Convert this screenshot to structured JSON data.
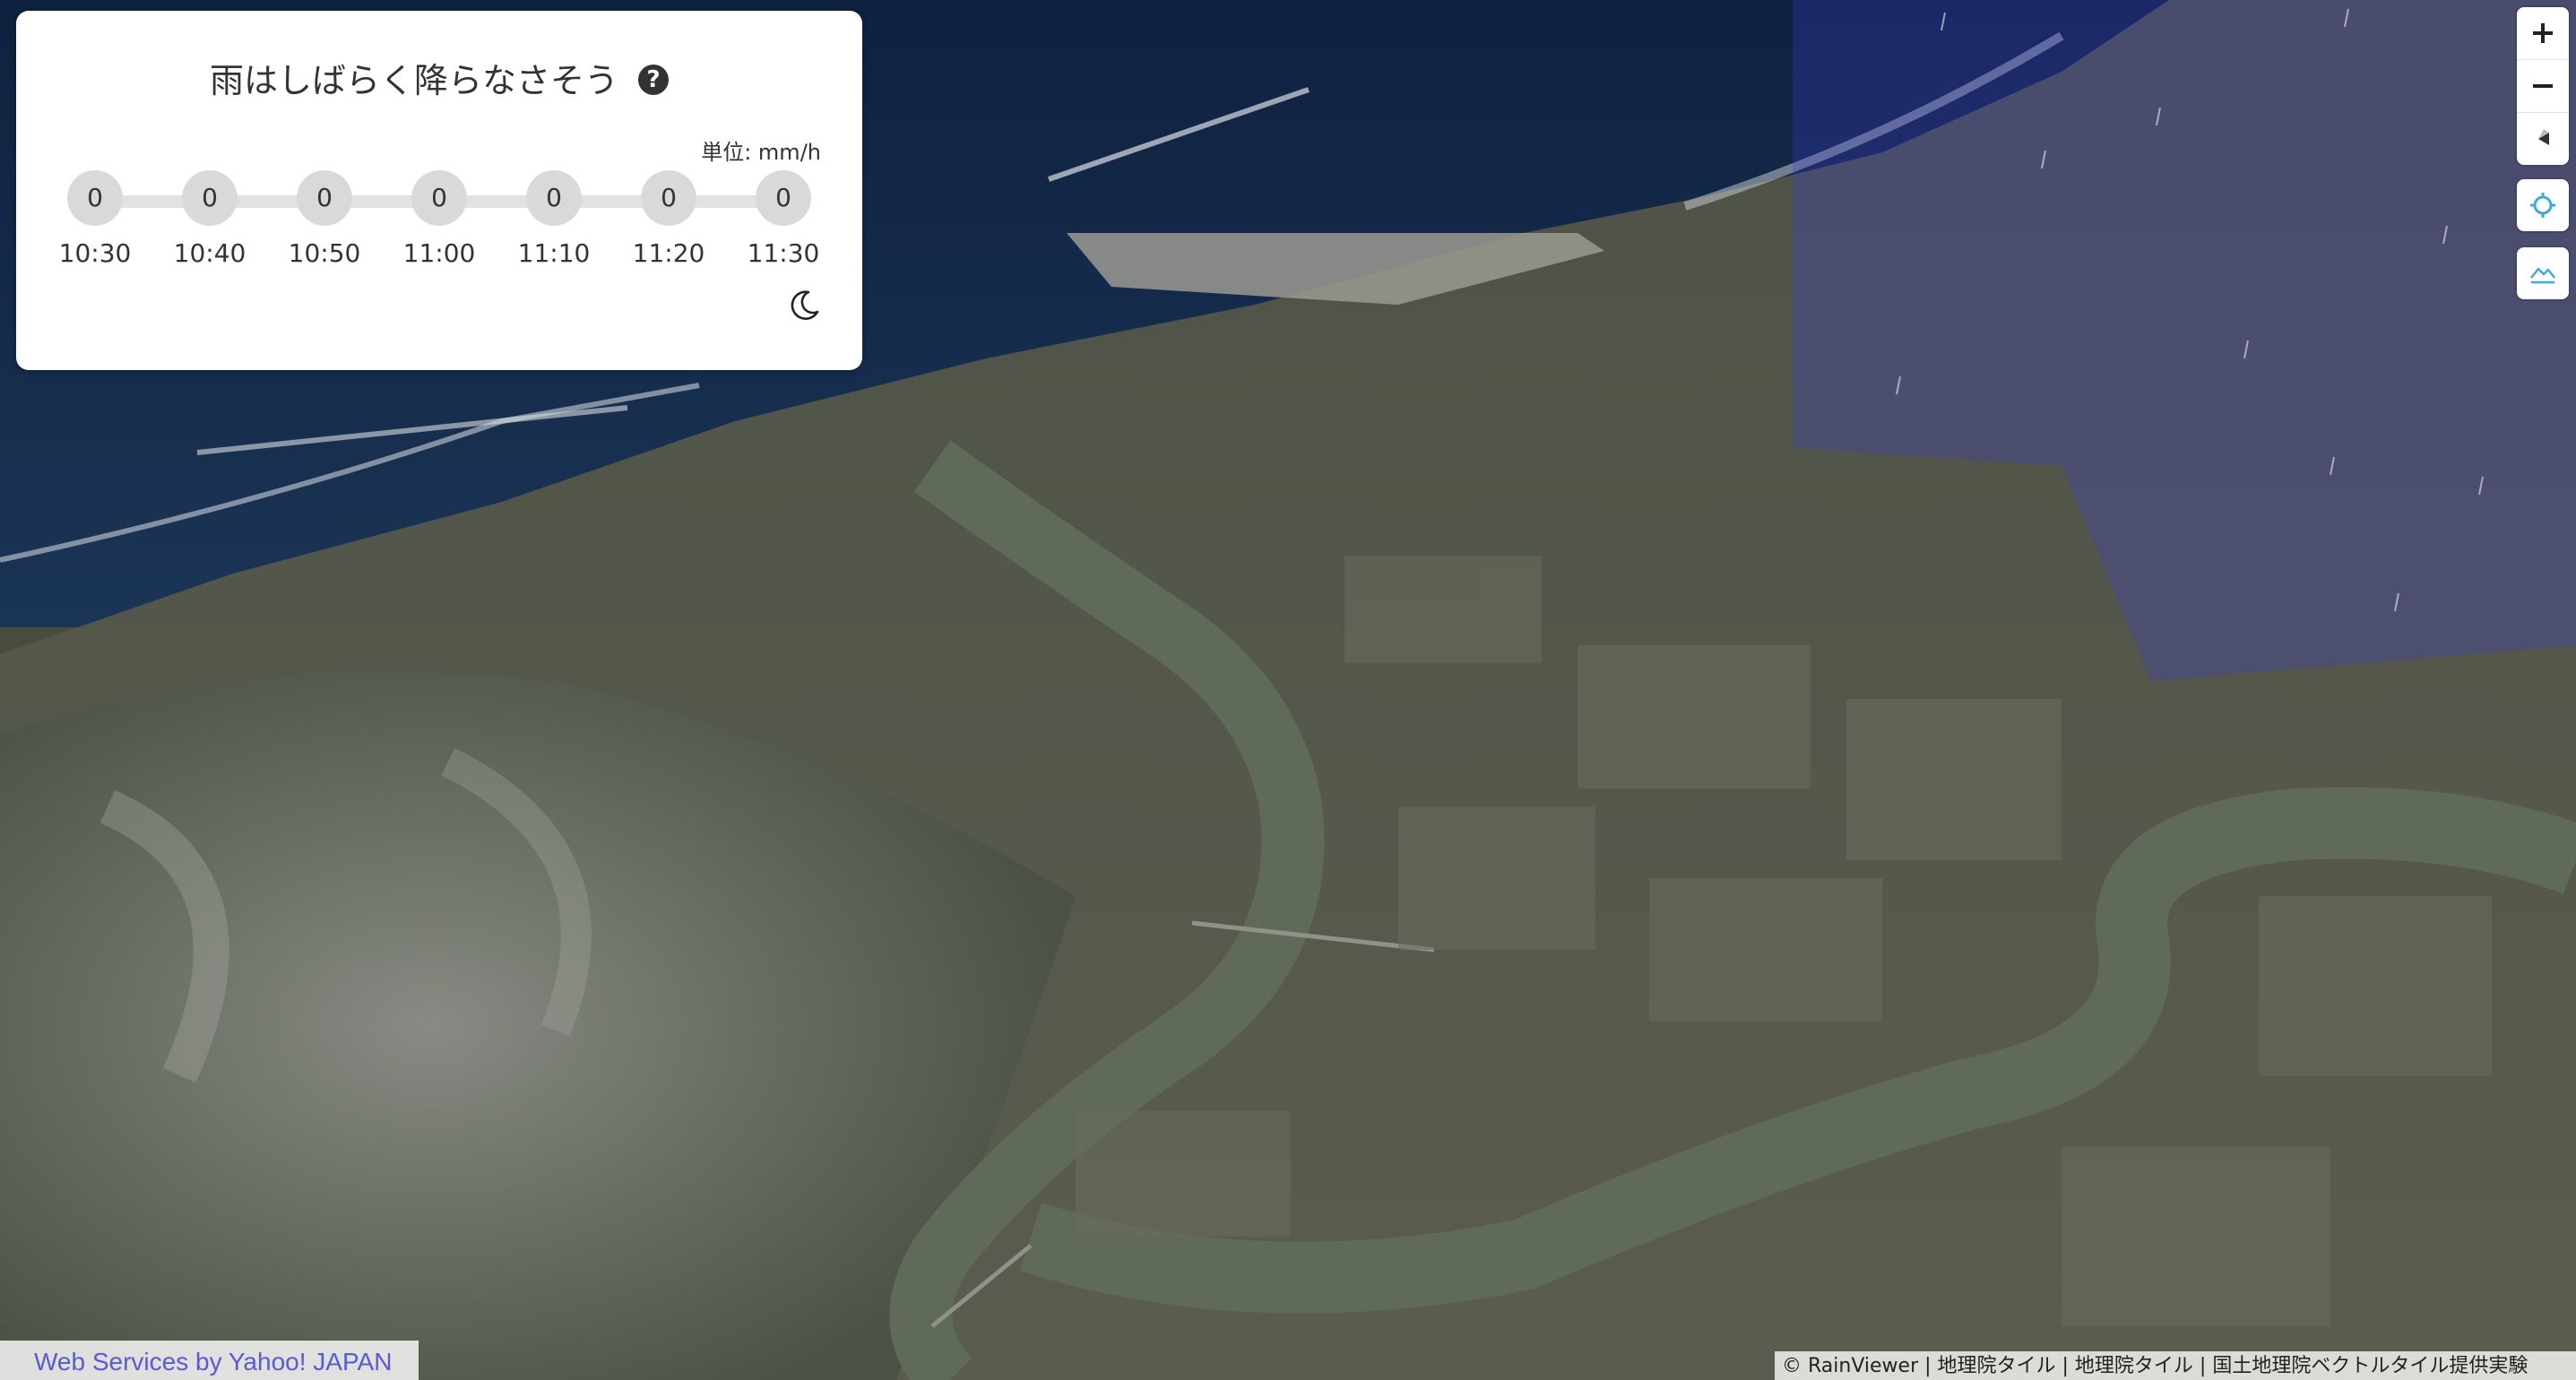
{
  "panel": {
    "title": "雨はしばらく降らなさそう",
    "help_icon": "?",
    "unit": "単位: mm/h",
    "forecast": [
      {
        "time": "10:30",
        "value": "0"
      },
      {
        "time": "10:40",
        "value": "0"
      },
      {
        "time": "10:50",
        "value": "0"
      },
      {
        "time": "11:00",
        "value": "0"
      },
      {
        "time": "11:10",
        "value": "0"
      },
      {
        "time": "11:20",
        "value": "0"
      },
      {
        "time": "11:30",
        "value": "0"
      }
    ],
    "theme_icon": "moon-icon"
  },
  "controls": {
    "zoom_in": "zoom-in-icon",
    "zoom_out": "zoom-out-icon",
    "compass": "compass-icon",
    "geolocate": "geolocate-icon",
    "terrain": "terrain-icon"
  },
  "attribution": {
    "yahoo": "Web Services by Yahoo! JAPAN",
    "sources": "© RainViewer | 地理院タイル | 地理院タイル | 国土地理院ベクトルタイル提供実験"
  },
  "colors": {
    "sea": "#13294a",
    "land": "#55574a",
    "river": "#5f6a58",
    "rain_overlay": "#3c3cd2",
    "link": "#5a5ad6"
  }
}
